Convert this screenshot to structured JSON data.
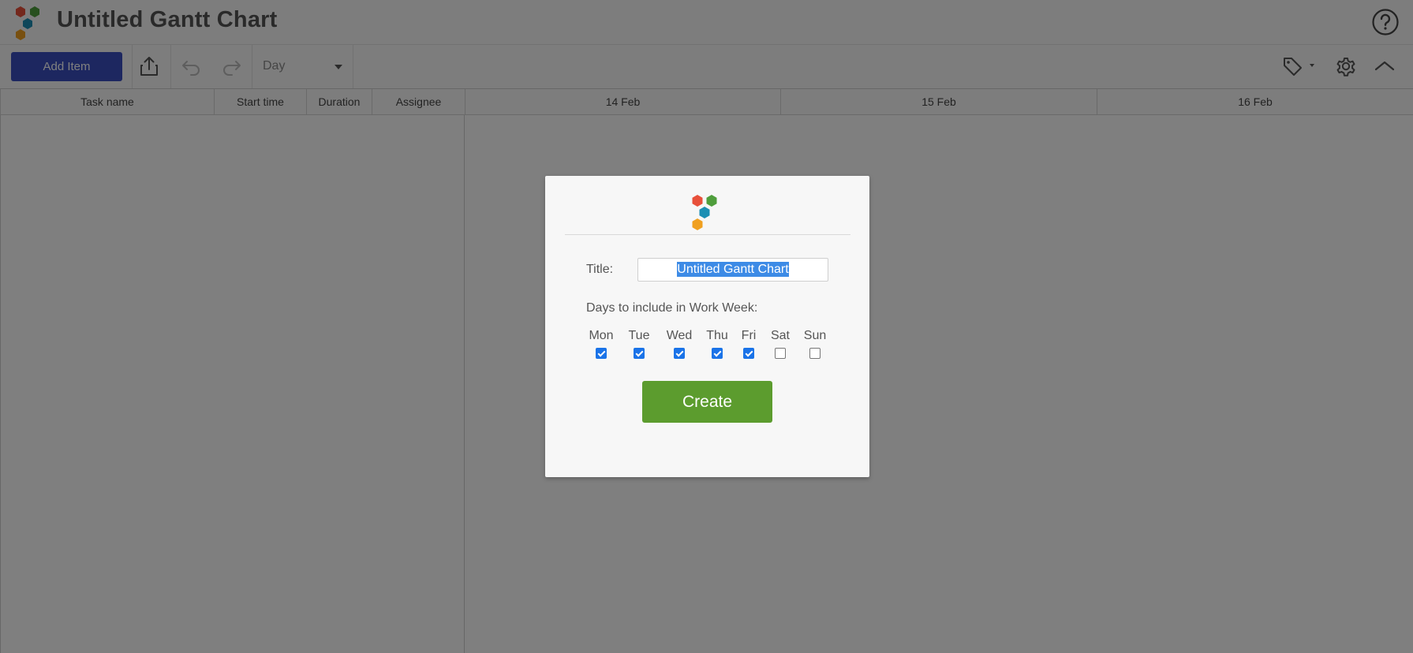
{
  "header": {
    "title": "Untitled Gantt Chart",
    "help_icon": "help-circle-icon"
  },
  "toolbar": {
    "add_item_label": "Add Item",
    "export_icon": "share-upload-icon",
    "undo_icon": "undo-icon",
    "redo_icon": "redo-icon",
    "view_value": "Day",
    "tag_icon": "tag-icon",
    "settings_icon": "gear-icon",
    "collapse_icon": "chevron-up-icon"
  },
  "grid": {
    "columns": [
      "Task name",
      "Start time",
      "Duration",
      "Assignee"
    ],
    "dates": [
      "14 Feb",
      "15 Feb",
      "16 Feb"
    ]
  },
  "modal": {
    "title_label": "Title:",
    "title_value": "Untitled Gantt Chart",
    "workweek_label": "Days to include in Work Week:",
    "days": [
      {
        "name": "Mon",
        "checked": true
      },
      {
        "name": "Tue",
        "checked": true
      },
      {
        "name": "Wed",
        "checked": true
      },
      {
        "name": "Thu",
        "checked": true
      },
      {
        "name": "Fri",
        "checked": true
      },
      {
        "name": "Sat",
        "checked": false
      },
      {
        "name": "Sun",
        "checked": false
      }
    ],
    "create_label": "Create"
  },
  "colors": {
    "brand_blue": "#3a4fc0",
    "create_green": "#5c9c2e",
    "hex_red": "#e8503a",
    "hex_green": "#4f9e3c",
    "hex_teal": "#1c8fb4",
    "hex_orange": "#f0a020"
  }
}
